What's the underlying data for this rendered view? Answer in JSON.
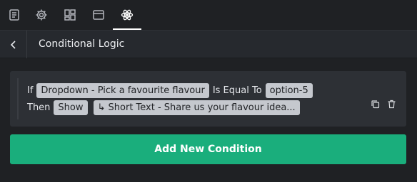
{
  "tabs": [
    {
      "icon": "form-icon"
    },
    {
      "icon": "gear-icon"
    },
    {
      "icon": "layout-icon"
    },
    {
      "icon": "window-icon"
    },
    {
      "icon": "atom-icon",
      "active": true
    }
  ],
  "header": {
    "title": "Conditional Logic"
  },
  "condition": {
    "if_label": "If",
    "field": "Dropdown - Pick a favourite flavour",
    "operator": "Is Equal To",
    "value": "option-5",
    "then_label": "Then",
    "action": "Show",
    "target": "↳ Short Text - Share us your flavour idea..."
  },
  "add_button": {
    "label": "Add New Condition"
  },
  "colors": {
    "accent": "#1aae7c",
    "chip": "#c5c8ce",
    "background": "#1f2124",
    "card": "#2d3035"
  }
}
